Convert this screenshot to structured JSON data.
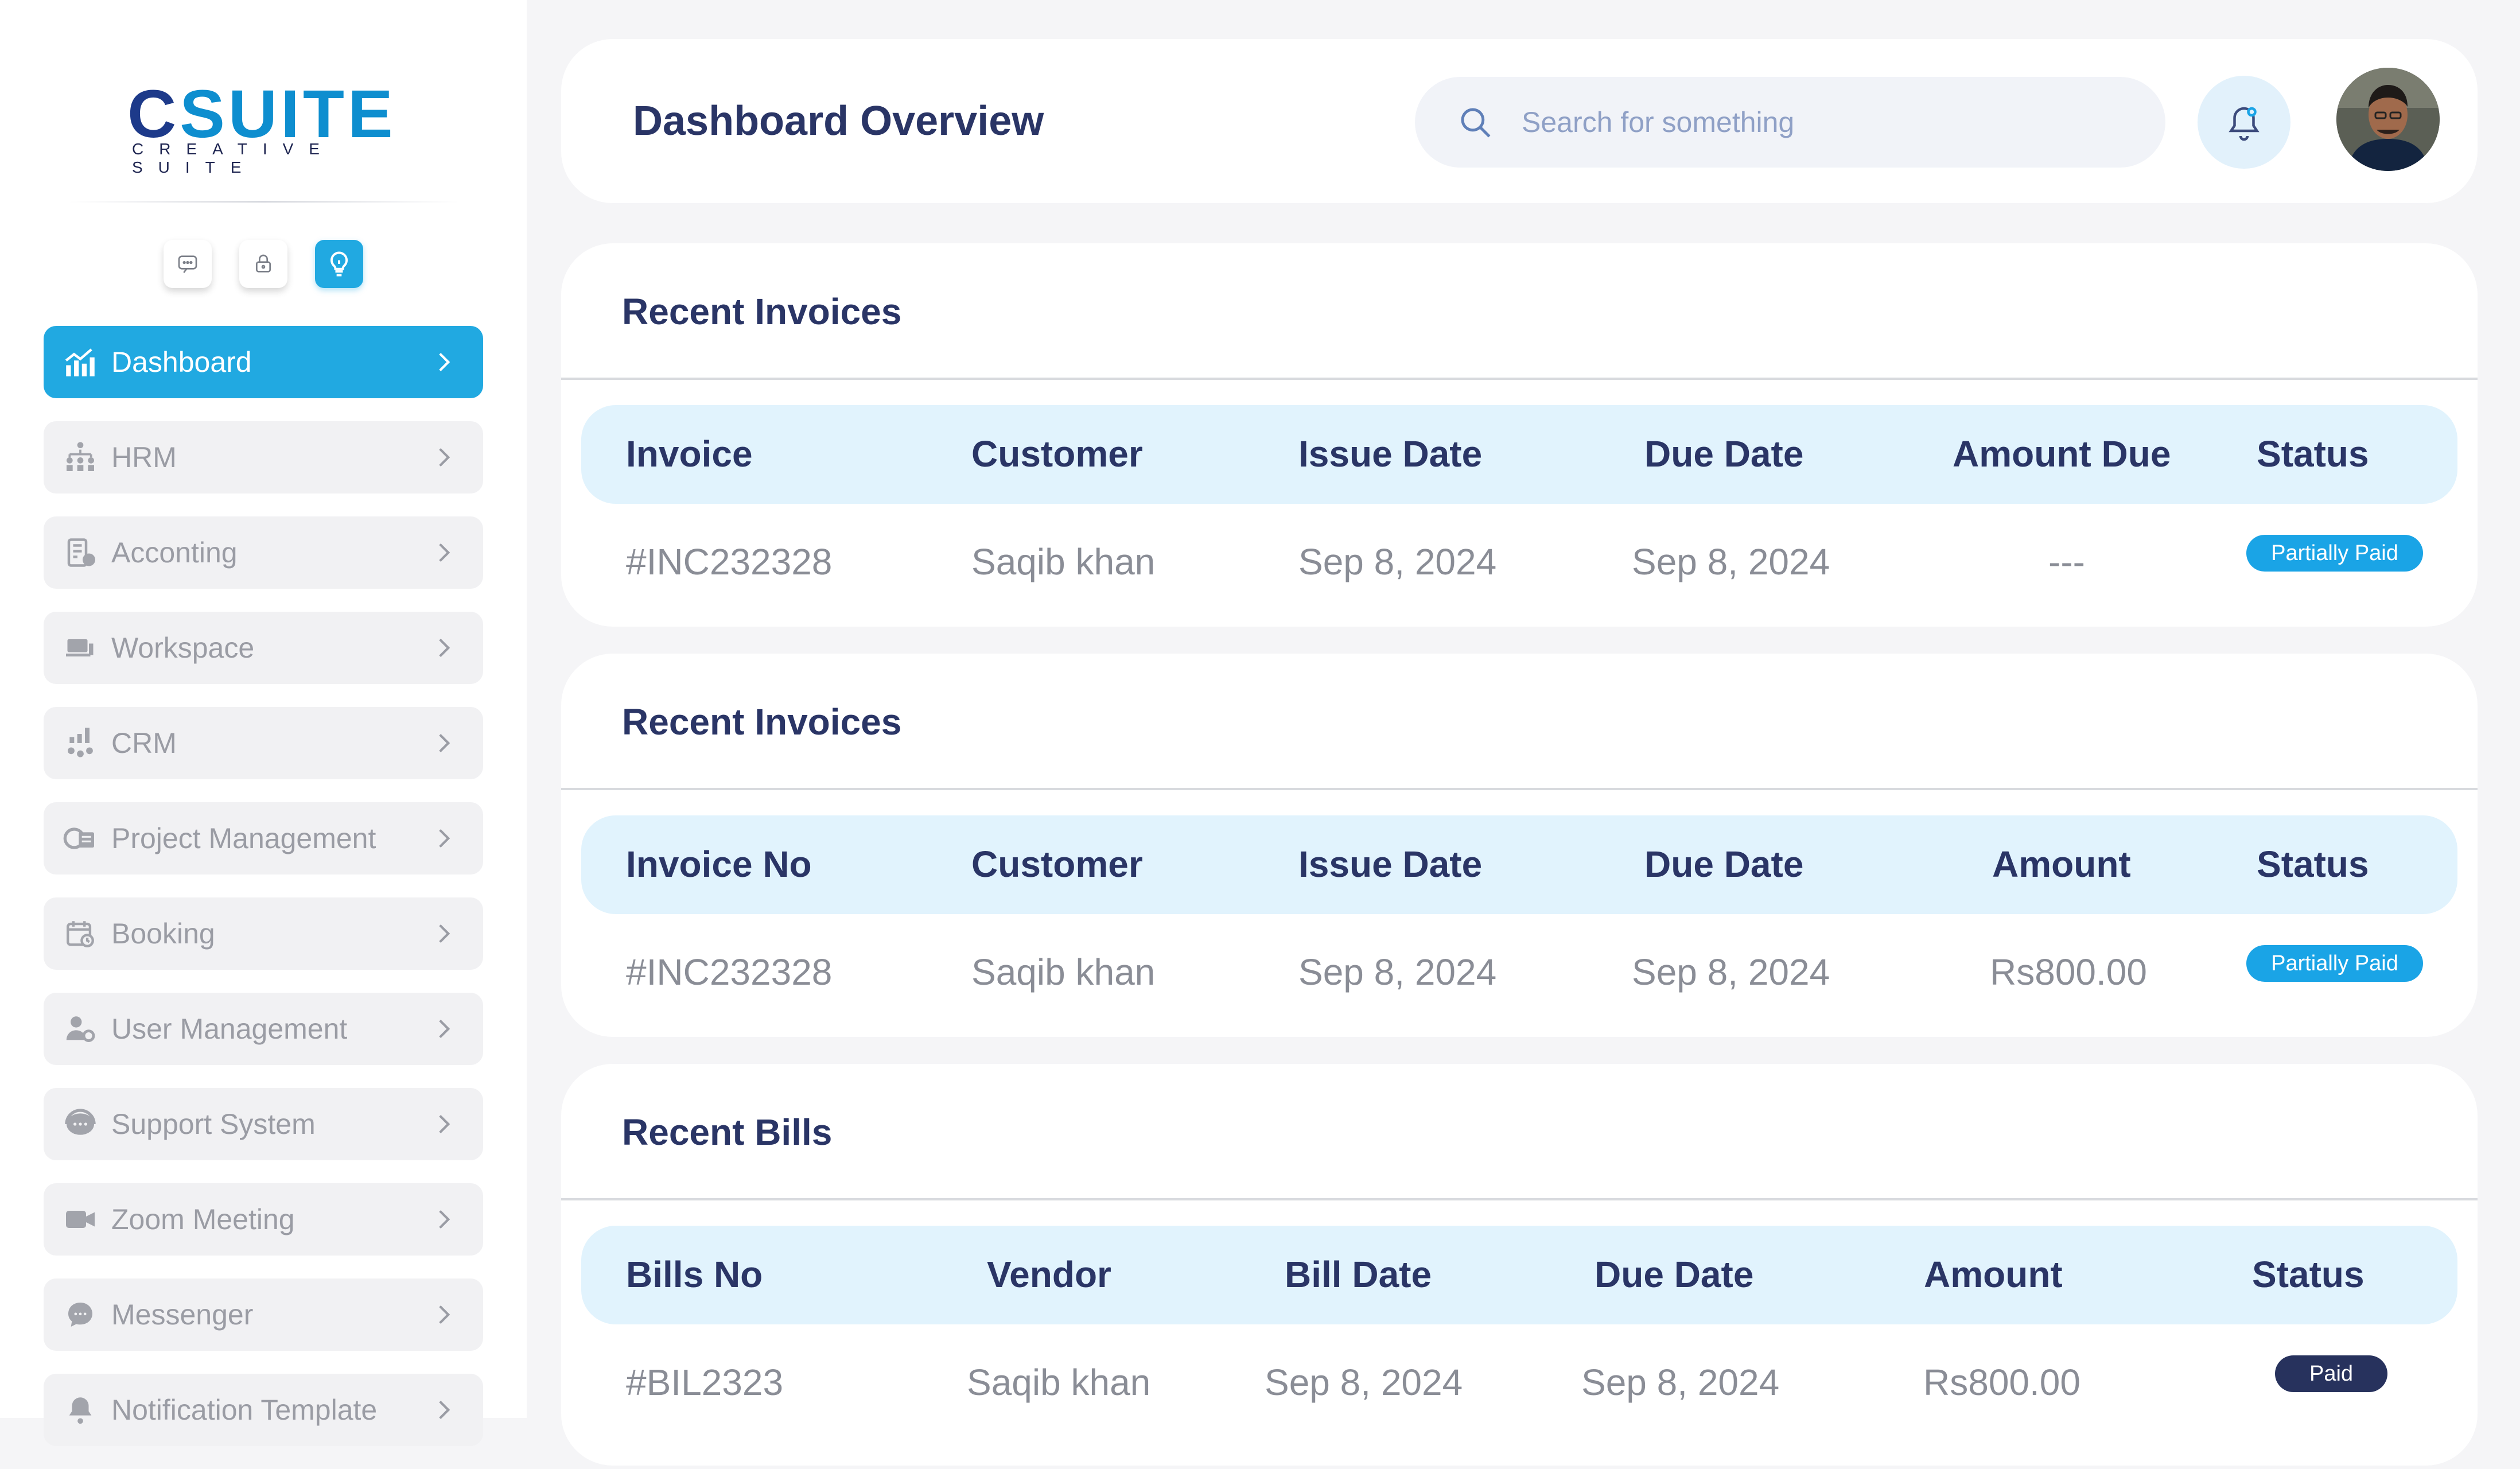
{
  "brand": {
    "name_prefix": "C",
    "name_rest": "SUITE",
    "tagline": "CREATIVE SUITE",
    "accent": "#21a9e1"
  },
  "quick_icons": [
    "chat-icon",
    "lock-icon",
    "idea-bulb-icon"
  ],
  "sidebar": {
    "items": [
      {
        "label": "Dashboard",
        "icon": "chart-icon",
        "active": true
      },
      {
        "label": "HRM",
        "icon": "org-chart-icon"
      },
      {
        "label": "Acconting",
        "icon": "accounting-icon"
      },
      {
        "label": "Workspace",
        "icon": "workspace-icon"
      },
      {
        "label": "CRM",
        "icon": "crm-icon"
      },
      {
        "label": "Project Management",
        "icon": "project-icon"
      },
      {
        "label": "Booking",
        "icon": "calendar-icon"
      },
      {
        "label": "User Management",
        "icon": "user-gear-icon"
      },
      {
        "label": "Support System",
        "icon": "support-icon"
      },
      {
        "label": "Zoom Meeting",
        "icon": "video-icon"
      },
      {
        "label": "Messenger",
        "icon": "messenger-icon"
      },
      {
        "label": "Notification Template",
        "icon": "notification-icon"
      }
    ]
  },
  "header": {
    "title": "Dashboard Overview",
    "search_placeholder": "Search for something"
  },
  "cards": [
    {
      "title": "Recent Invoices",
      "columns": [
        "Invoice",
        "Customer",
        "Issue Date",
        "Due Date",
        "Amount Due",
        "Status"
      ],
      "rows": [
        [
          "#INC232328",
          "Saqib khan",
          "Sep 8, 2024",
          "Sep 8, 2024",
          "---",
          "Partially Paid"
        ]
      ]
    },
    {
      "title": "Recent Invoices",
      "columns": [
        "Invoice No",
        "Customer",
        "Issue Date",
        "Due Date",
        "Amount",
        "Status"
      ],
      "rows": [
        [
          "#INC232328",
          "Saqib khan",
          "Sep 8, 2024",
          "Sep 8, 2024",
          "Rs800.00",
          "Partially Paid"
        ]
      ]
    },
    {
      "title": "Recent Bills",
      "columns": [
        "Bills No",
        "Vendor",
        "Bill Date",
        "Due Date",
        "Amount",
        "Status"
      ],
      "rows": [
        [
          "#BIL2323",
          "Saqib khan",
          "Sep 8, 2024",
          "Sep 8, 2024",
          "Rs800.00",
          "Paid"
        ]
      ]
    }
  ]
}
